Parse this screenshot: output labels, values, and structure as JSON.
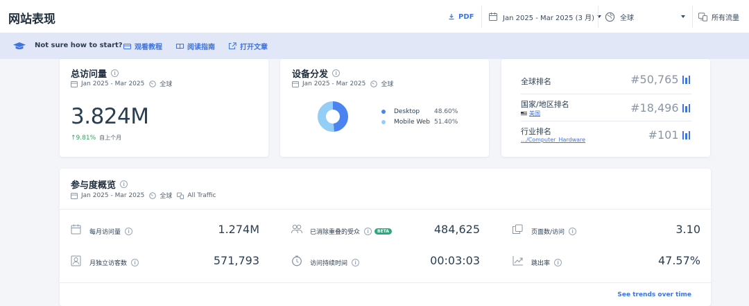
{
  "header": {
    "title": "网站表现",
    "pdf_label": "PDF",
    "date_range": "Jan 2025 - Mar 2025 (3 月)",
    "region": "全球",
    "traffic": "所有流量"
  },
  "helpbar": {
    "question": "Not sure how to start?",
    "links": [
      "观看教程",
      "阅读指南",
      "打开文章"
    ]
  },
  "visits_card": {
    "title": "总访问量",
    "date": "Jan 2025 - Mar 2025",
    "region": "全球",
    "value": "3.824M",
    "growth": "↑9.81%",
    "growth_label": "自上个月"
  },
  "device_card": {
    "title": "设备分发",
    "date": "Jan 2025 - Mar 2025",
    "region": "全球",
    "chart_data": {
      "type": "pie",
      "categories": [
        "Desktop",
        "Mobile Web"
      ],
      "values": [
        48.6,
        51.4
      ],
      "labels": [
        "48.60%",
        "51.40%"
      ],
      "colors": [
        "#4b83f0",
        "#94cdf6"
      ]
    }
  },
  "rank_card": {
    "global_label": "全球排名",
    "global_value": "#50,765",
    "country_label": "国家/地区排名",
    "country_name": "美国",
    "country_value": "#18,496",
    "industry_label": "行业排名",
    "industry_name": "…/Computer_Hardware",
    "industry_value": "#101"
  },
  "engagement": {
    "title": "参与度概览",
    "date": "Jan 2025 - Mar 2025",
    "region": "全球",
    "traffic": "All Traffic",
    "metrics": [
      {
        "label": "每月访问量",
        "value": "1.274M",
        "icon": "calendar-icon"
      },
      {
        "label": "已消除重叠的受众",
        "value": "484,625",
        "icon": "people-icon",
        "badge": "BETA"
      },
      {
        "label": "页面数/访问",
        "value": "3.10",
        "icon": "pages-icon"
      },
      {
        "label": "月独立访客数",
        "value": "571,793",
        "icon": "visitor-icon"
      },
      {
        "label": "访问持续时间",
        "value": "00:03:03",
        "icon": "clock-icon"
      },
      {
        "label": "跳出率",
        "value": "47.57%",
        "icon": "bounce-icon"
      }
    ],
    "trends_link": "See trends over time"
  }
}
